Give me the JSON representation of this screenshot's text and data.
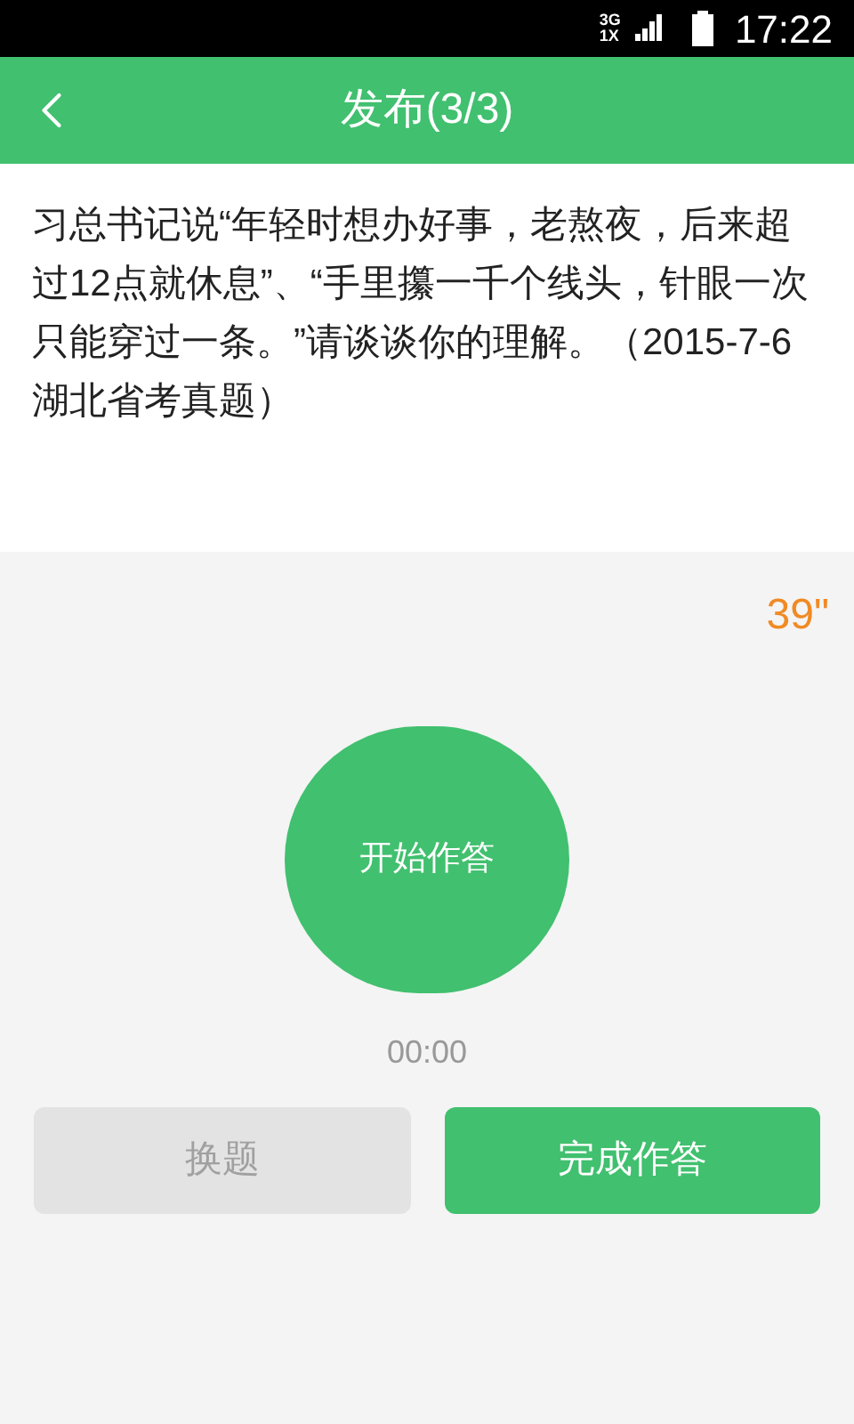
{
  "status_bar": {
    "network_top": "3G",
    "network_bottom": "1X",
    "time": "17:22"
  },
  "header": {
    "title": "发布(3/3)"
  },
  "question": {
    "text": "习总书记说“年轻时想办好事，老熬夜，后来超过12点就休息”、“手里攥一千个线头，针眼一次只能穿过一条。”请谈谈你的理解。（2015-7-6湖北省考真题）"
  },
  "countdown": "39\"",
  "record_button": {
    "label": "开始作答"
  },
  "elapsed": "00:00",
  "buttons": [
    {
      "label": "换题",
      "disabled": true
    },
    {
      "label": "完成作答",
      "disabled": false
    }
  ]
}
